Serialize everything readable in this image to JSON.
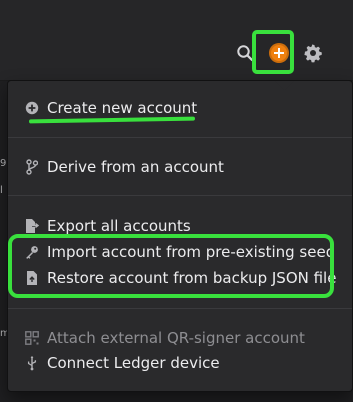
{
  "toolbar": {
    "icons": [
      "search-icon",
      "plus-circle-icon",
      "gear-icon"
    ],
    "accent": "#f0800f"
  },
  "background": {
    "edge_fragments": [
      "9",
      "l",
      "m"
    ]
  },
  "menu": {
    "groups": [
      {
        "items": [
          {
            "label": "Create new account",
            "icon": "plus-circle-icon",
            "enabled": true
          }
        ]
      },
      {
        "items": [
          {
            "label": "Derive from an account",
            "icon": "branch-icon",
            "enabled": true
          }
        ]
      },
      {
        "items": [
          {
            "label": "Export all accounts",
            "icon": "export-icon",
            "enabled": true
          },
          {
            "label": "Import account from pre-existing seed",
            "icon": "key-icon",
            "enabled": true
          },
          {
            "label": "Restore account from backup JSON file",
            "icon": "file-upload-icon",
            "enabled": true
          }
        ]
      },
      {
        "items": [
          {
            "label": "Attach external QR-signer account",
            "icon": "qr-icon",
            "enabled": false
          },
          {
            "label": "Connect Ledger device",
            "icon": "usb-icon",
            "enabled": true
          }
        ]
      }
    ]
  },
  "annotations": {
    "color": "#39e03d"
  }
}
